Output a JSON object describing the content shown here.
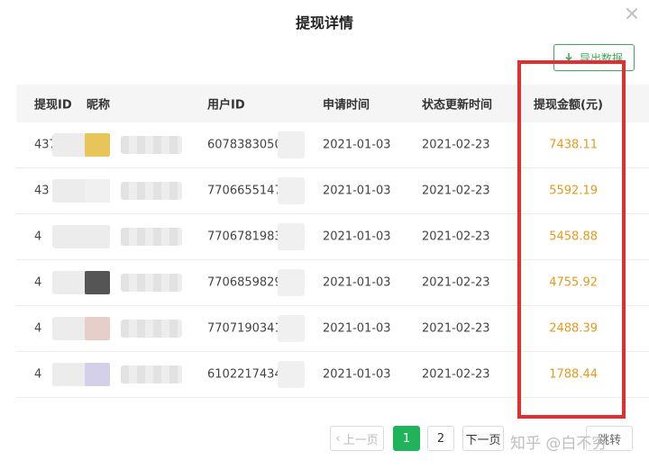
{
  "dialog": {
    "title": "提现详情",
    "export_label": "导出数据"
  },
  "table": {
    "headers": {
      "id": "提现ID",
      "nickname": "昵称",
      "user_id": "用户ID",
      "apply_time": "申请时间",
      "update_time": "状态更新时间",
      "amount": "提现金额(元)"
    },
    "rows": [
      {
        "id": "437",
        "user_id": "607838305002",
        "apply_time": "2021-01-03",
        "update_time": "2021-02-23",
        "amount": "7438.11",
        "avatar_color": "#e8c558"
      },
      {
        "id": "43",
        "user_id": "770665514797",
        "apply_time": "2021-01-03",
        "update_time": "2021-02-23",
        "amount": "5592.19",
        "avatar_color": "#f0f0f0"
      },
      {
        "id": "4",
        "user_id": "770678198374",
        "apply_time": "2021-01-03",
        "update_time": "2021-02-23",
        "amount": "5458.88",
        "avatar_color": "#ececec"
      },
      {
        "id": "4",
        "user_id": "770685982991",
        "apply_time": "2021-01-03",
        "update_time": "2021-02-23",
        "amount": "4755.92",
        "avatar_color": "#555555"
      },
      {
        "id": "4",
        "user_id": "770719034111",
        "apply_time": "2021-01-03",
        "update_time": "2021-02-23",
        "amount": "2488.39",
        "avatar_color": "#e6cfc8"
      },
      {
        "id": "4",
        "user_id": "610221743401",
        "apply_time": "2021-01-03",
        "update_time": "2021-02-23",
        "amount": "1788.44",
        "avatar_color": "#d4d0ea"
      }
    ]
  },
  "pagination": {
    "prev": "上一页",
    "page1": "1",
    "page2": "2",
    "next": "下一页",
    "jump": "跳转"
  },
  "watermark": "知乎 @白不穷",
  "colors": {
    "accent": "#1fb35a",
    "amount": "#e59a1c",
    "highlight": "#e02f2f"
  }
}
